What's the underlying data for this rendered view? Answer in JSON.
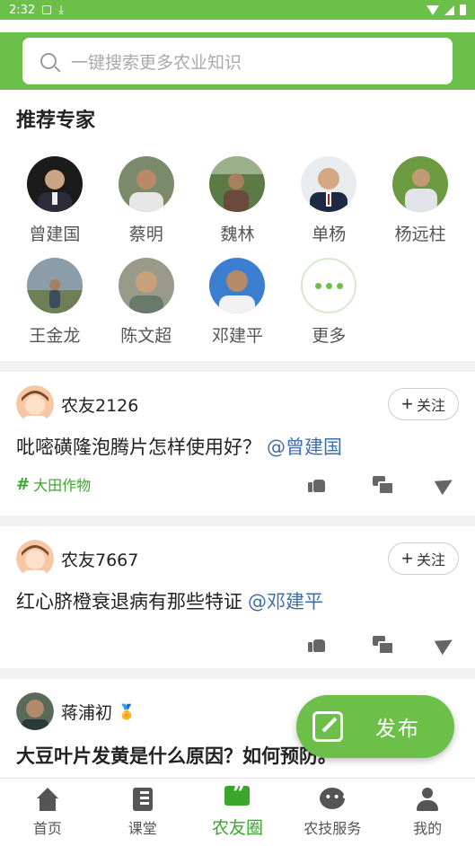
{
  "status_bar": {
    "time": "2:32",
    "notif_a": "A"
  },
  "search": {
    "placeholder": "一键搜索更多农业知识"
  },
  "experts": {
    "title": "推荐专家",
    "items": [
      {
        "name": "曾建国",
        "bg": "#1b1b1b",
        "face": "#c9a585"
      },
      {
        "name": "蔡明",
        "bg": "#7a8a6a",
        "face": "#b88a6a"
      },
      {
        "name": "魏林",
        "bg": "#5c7a45",
        "face": "#a6805f"
      },
      {
        "name": "单杨",
        "bg": "#e9ecef",
        "face": "#d3a883"
      },
      {
        "name": "杨远柱",
        "bg": "#6c9a40",
        "face": "#c39a76"
      },
      {
        "name": "王金龙",
        "bg": "#8a9da8",
        "face": "#a57f60"
      },
      {
        "name": "陈文超",
        "bg": "#9a9a8a",
        "face": "#c8a07c"
      },
      {
        "name": "邓建平",
        "bg": "#3c7fd0",
        "face": "#b58a66"
      }
    ],
    "more_label": "更多"
  },
  "posts": [
    {
      "user": "农友2126",
      "follow": "关注",
      "text": "吡嘧磺隆泡腾片怎样使用好？",
      "mention": "@曾建国",
      "tag": "大田作物"
    },
    {
      "user": "农友7667",
      "follow": "关注",
      "text": "红心脐橙衰退病有那些特证",
      "mention": "@邓建平",
      "tag": ""
    },
    {
      "user": "蒋浦初",
      "badge": "🏅",
      "text": "大豆叶片发黄是什么原因？如何预防。"
    }
  ],
  "fab": {
    "label": "发布"
  },
  "tabs": [
    {
      "label": "首页"
    },
    {
      "label": "课堂"
    },
    {
      "label": "农友圈"
    },
    {
      "label": "农技服务"
    },
    {
      "label": "我的"
    }
  ],
  "colors": {
    "primary": "#6cc04a",
    "mention": "#3f6fa8",
    "tag": "#3aa62c"
  }
}
